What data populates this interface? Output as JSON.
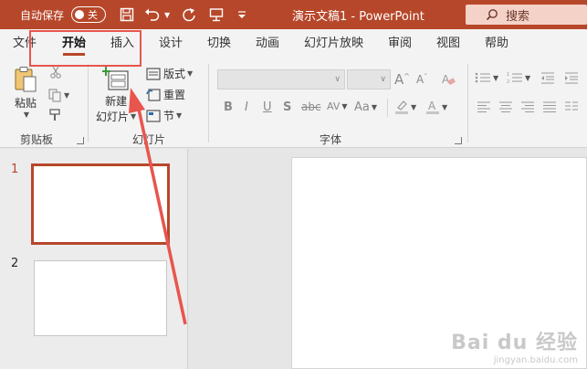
{
  "titlebar": {
    "autosave_label": "自动保存",
    "toggle_state": "关",
    "doc_title": "演示文稿1  -  PowerPoint",
    "search_label": "搜索",
    "qa_icons": [
      "save-icon",
      "undo-icon",
      "redo-icon",
      "present-icon",
      "customize-icon"
    ]
  },
  "tabs": [
    "文件",
    "开始",
    "插入",
    "设计",
    "切换",
    "动画",
    "幻灯片放映",
    "审阅",
    "视图",
    "帮助"
  ],
  "active_tab": "开始",
  "ribbon": {
    "clipboard": {
      "paste_label": "粘贴",
      "group_label": "剪贴板"
    },
    "slides": {
      "new_slide_line1": "新建",
      "new_slide_line2": "幻灯片",
      "layout_label": "版式",
      "reset_label": "重置",
      "section_label": "节",
      "group_label": "幻灯片"
    },
    "font": {
      "grow_label": "A",
      "shrink_label": "A",
      "bold": "B",
      "italic": "I",
      "underline": "U",
      "shadow": "S",
      "strike": "abc",
      "spacing": "AV",
      "case": "Aa",
      "group_label": "字体"
    }
  },
  "slides_panel": {
    "slides": [
      {
        "number": "1",
        "selected": true
      },
      {
        "number": "2",
        "selected": false
      }
    ]
  },
  "watermark": {
    "main": "Bai du 经验",
    "sub": "jingyan.baidu.com"
  },
  "colors": {
    "accent": "#b7472a",
    "annotation": "#e8554e"
  }
}
